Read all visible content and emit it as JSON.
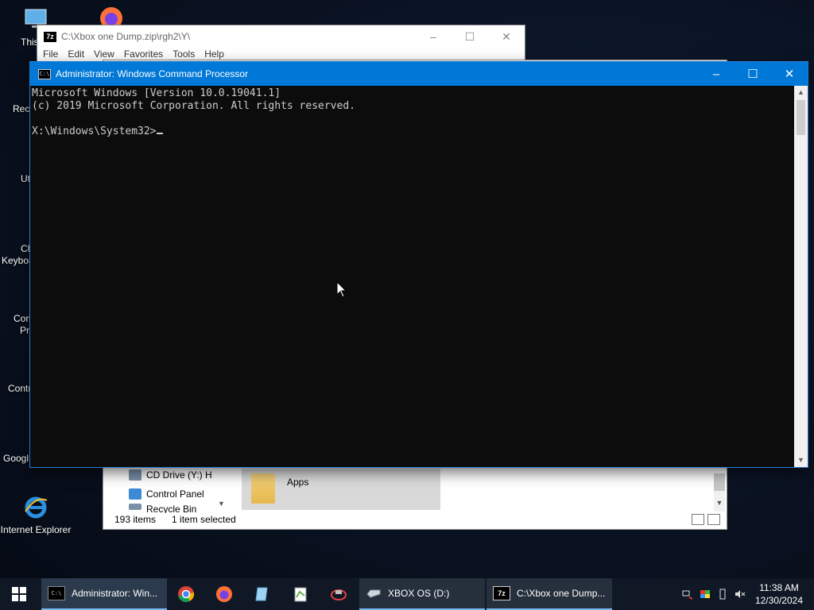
{
  "desktop": {
    "icons": [
      {
        "label": "This",
        "icon": "this-pc-icon"
      },
      {
        "label": "Recy",
        "icon": "recycle-bin-icon"
      },
      {
        "label": "Uti",
        "icon": "folder-icon"
      },
      {
        "label": "Ch",
        "label2": "Keyboa",
        "icon": "keyboard-icon"
      },
      {
        "label": "Com",
        "label2": "Pr",
        "icon": "command-prompt-icon"
      },
      {
        "label": "Contr",
        "icon": "control-panel-icon"
      },
      {
        "label": "Googl",
        "icon": "chrome-icon"
      },
      {
        "label": "Internet Explorer",
        "icon": "internet-explorer-icon"
      }
    ]
  },
  "sevenzip": {
    "title": "C:\\Xbox one Dump.zip\\rgh2\\Y\\",
    "menu": [
      "File",
      "Edit",
      "View",
      "Favorites",
      "Tools",
      "Help"
    ]
  },
  "explorer": {
    "nav": [
      "CD Drive (Y:) H",
      "Control Panel",
      "Recycle Bin"
    ],
    "folder": "Apps",
    "status_items": "193 items",
    "status_selected": "1 item selected"
  },
  "cmd": {
    "title": "Administrator: Windows Command Processor",
    "lines": [
      "Microsoft Windows [Version 10.0.19041.1]",
      "(c) 2019 Microsoft Corporation. All rights reserved.",
      "",
      "X:\\Windows\\System32>"
    ]
  },
  "taskbar": {
    "apps": [
      {
        "label": "Administrator: Win...",
        "icon": "cmd-icon",
        "state": "active"
      },
      {
        "label": "XBOX OS (D:)",
        "icon": "drive-icon",
        "state": "open"
      },
      {
        "label": "C:\\Xbox one Dump...",
        "icon": "7zip-icon",
        "state": "open"
      }
    ],
    "pinned": [
      "chrome-icon",
      "firefox-icon",
      "notepad-icon",
      "notepad-plus-icon",
      "tool-icon"
    ],
    "time": "11:38 AM",
    "date": "12/30/2024"
  },
  "colors": {
    "titlebar": "#0078d7",
    "console_bg": "#0c0c0c",
    "console_text": "#cccccc",
    "taskbar": "#101826"
  }
}
